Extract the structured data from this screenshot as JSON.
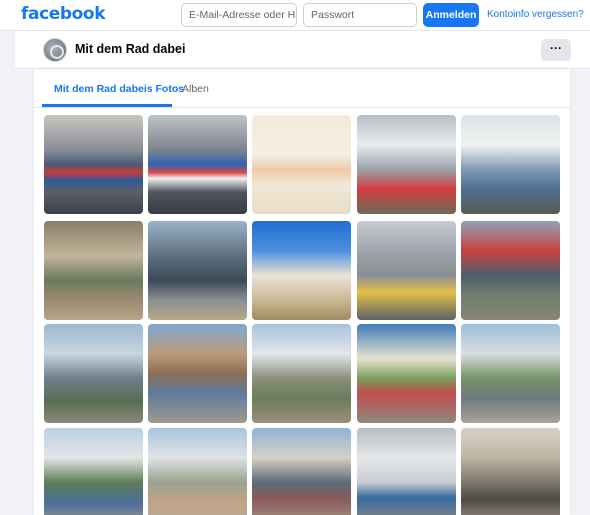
{
  "topbar": {
    "logo": "facebook",
    "email_placeholder": "E-Mail-Adresse oder Ha",
    "password_placeholder": "Passwort",
    "login_button": "Anmelden",
    "forgot_link": "Kontoinfo vergessen?"
  },
  "page": {
    "name": "Mit dem Rad dabei",
    "more_button": "···"
  },
  "tabs": [
    {
      "label": "Mit dem Rad dabeis Fotos",
      "active": true
    },
    {
      "label": "Alben",
      "active": false
    }
  ],
  "photos": [
    {
      "name": "photo-flyer-1"
    },
    {
      "name": "photo-flyer-2"
    },
    {
      "name": "photo-familien-fahrradtour-flyer"
    },
    {
      "name": "photo-info-board-red-bike"
    },
    {
      "name": "photo-crowd-tent"
    },
    {
      "name": "photo-kids-bikes-1"
    },
    {
      "name": "photo-people-street"
    },
    {
      "name": "photo-helmet-table"
    },
    {
      "name": "photo-sign-stand"
    },
    {
      "name": "photo-group-bikes"
    },
    {
      "name": "photo-building-tent"
    },
    {
      "name": "photo-market-stands"
    },
    {
      "name": "photo-event-crowd"
    },
    {
      "name": "photo-colorful-umbrella"
    },
    {
      "name": "photo-kids-park"
    },
    {
      "name": "photo-apartment-block"
    },
    {
      "name": "photo-course-cones"
    },
    {
      "name": "photo-square-crowd"
    },
    {
      "name": "photo-repair-table"
    },
    {
      "name": "photo-bike-repair"
    }
  ]
}
